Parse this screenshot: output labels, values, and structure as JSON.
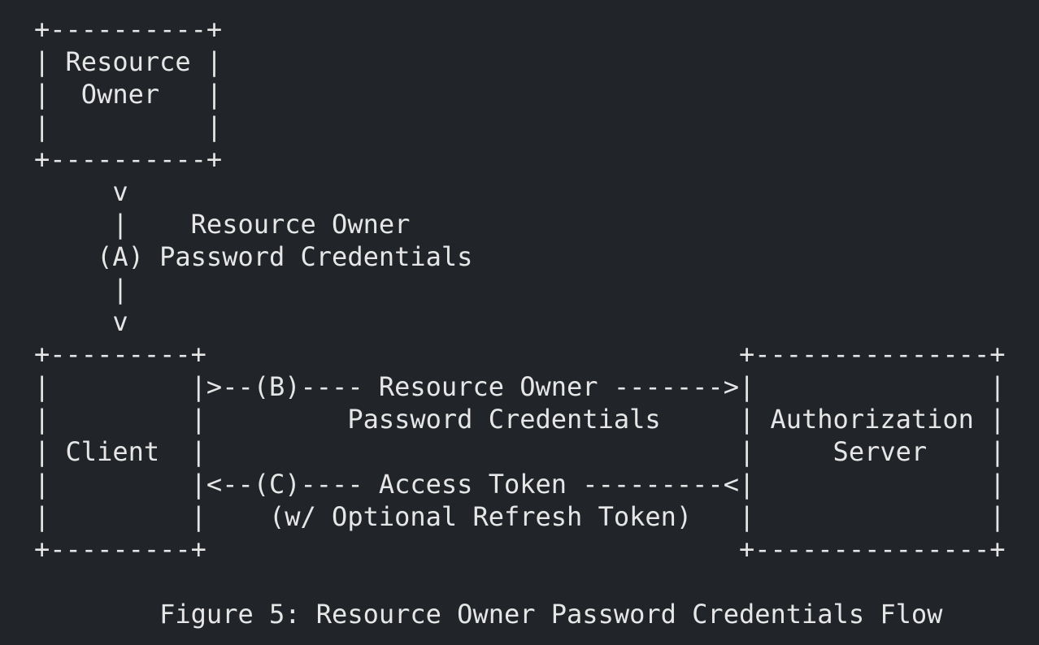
{
  "diagram": {
    "lines": [
      "+----------+",
      "| Resource |",
      "|  Owner   |",
      "|          |",
      "+----------+",
      "     v",
      "     |    Resource Owner",
      "    (A) Password Credentials",
      "     |",
      "     v",
      "+---------+                                  +---------------+",
      "|         |>--(B)---- Resource Owner ------->|               |",
      "|         |         Password Credentials     | Authorization |",
      "| Client  |                                  |     Server    |",
      "|         |<--(C)---- Access Token ---------<|               |",
      "|         |    (w/ Optional Refresh Token)   |               |",
      "+---------+                                  +---------------+",
      "",
      "        Figure 5: Resource Owner Password Credentials Flow"
    ]
  }
}
